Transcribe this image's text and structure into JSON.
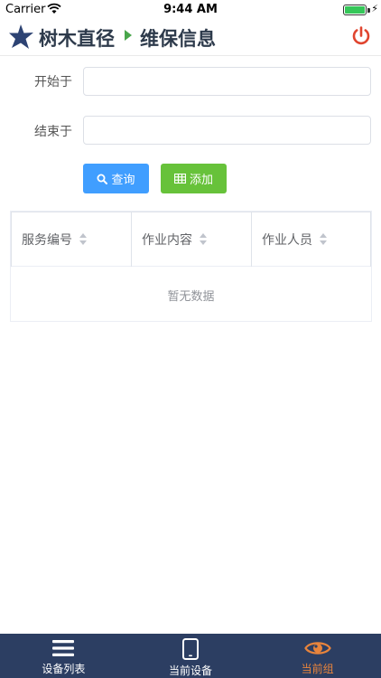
{
  "status_bar": {
    "carrier": "Carrier",
    "time": "9:44 AM"
  },
  "header": {
    "app_title": "树木直径",
    "page_title": "维保信息",
    "logo_icon": "star-logo-icon",
    "logout_icon": "power-icon",
    "accent_color": "#e0452f",
    "breadcrumb_arrow_color": "#49a64b"
  },
  "form": {
    "start_label": "开始于",
    "start_value": "",
    "end_label": "结束于",
    "end_value": ""
  },
  "buttons": {
    "query_label": "查询",
    "query_icon": "search-icon",
    "query_color": "#409eff",
    "add_label": "添加",
    "add_icon": "table-icon",
    "add_color": "#67c23a"
  },
  "table": {
    "columns": [
      "服务编号",
      "作业内容",
      "作业人员"
    ],
    "rows": [],
    "empty_text": "暂无数据"
  },
  "tab_bar": {
    "background": "#2c3e62",
    "active_color": "#e8843c",
    "tabs": [
      {
        "label": "设备列表",
        "icon": "list-icon",
        "active": false
      },
      {
        "label": "当前设备",
        "icon": "tablet-icon",
        "active": false
      },
      {
        "label": "当前组",
        "icon": "eye-icon",
        "active": true
      }
    ]
  }
}
